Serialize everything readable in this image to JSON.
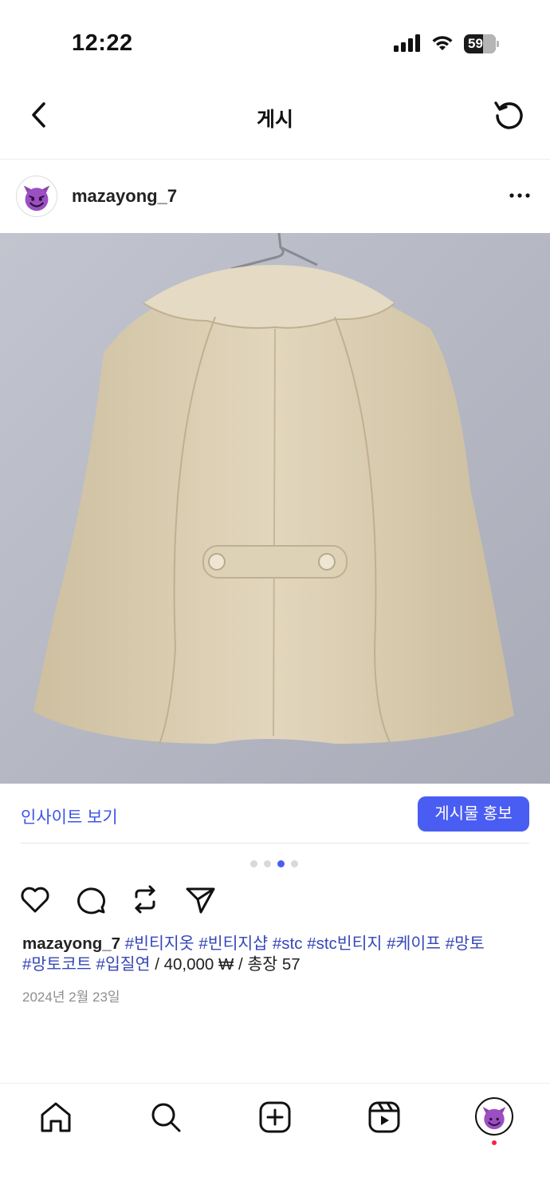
{
  "status_bar": {
    "time": "12:22",
    "battery": "59",
    "icons": [
      "signal-icon",
      "wifi-icon",
      "battery-icon"
    ]
  },
  "header": {
    "title": "게시",
    "back_icon": "chevron-left-icon",
    "refresh_icon": "refresh-icon"
  },
  "post": {
    "username": "mazayong_7",
    "avatar_icon": "smiling-devil-emoji",
    "more_icon": "more-horizontal-icon",
    "photo_description_icon": "beige-cape-coat-photo",
    "carousel": {
      "count": 4,
      "active_index": 2
    },
    "insights_label": "인사이트 보기",
    "promote_label": "게시물 홍보",
    "actions": [
      "heart-icon",
      "comment-icon",
      "repost-icon",
      "share-icon"
    ],
    "caption": {
      "username": "mazayong_7",
      "tags_line1": [
        "#빈티지옷",
        "#빈티지샵",
        "#stc",
        "#stc빈티지",
        "#케이프",
        "#망토"
      ],
      "tags_line2": [
        "#망토코트",
        "#입질연"
      ],
      "text": " / 40,000 ₩ / 총장 57"
    },
    "date": "2024년 2월 23일"
  },
  "tab_bar": {
    "items": [
      "home-icon",
      "search-icon",
      "create-icon",
      "reels-icon",
      "profile-avatar"
    ],
    "has_notification": true
  },
  "colors": {
    "accent": "#4a5df2",
    "link": "#3b55e6",
    "hashtag": "#3547b8",
    "notification": "#ff1f3d",
    "photo_background": "#b5b7c3",
    "coat": "#d9cbb0"
  }
}
